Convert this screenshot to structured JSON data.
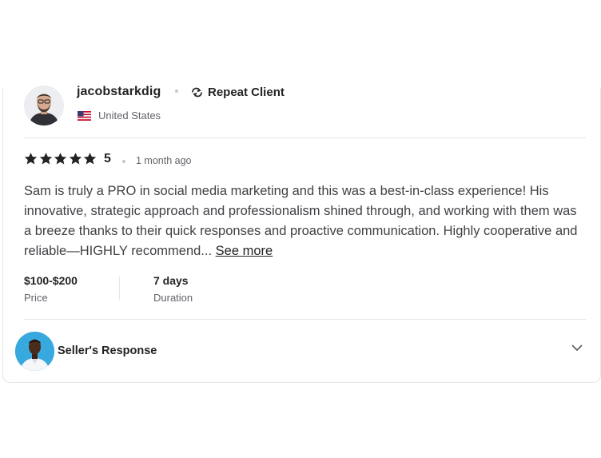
{
  "reviewer": {
    "username": "jacobstarkdig",
    "badge": "Repeat Client",
    "country": "United States",
    "avatar_icon": "reviewer-photo-icon"
  },
  "review": {
    "rating": "5",
    "stars_filled": 5,
    "date": "1 month ago",
    "text": "Sam is truly a PRO in social media marketing and this was a best-in-class experience! His innovative, strategic approach and professionalism shined through, and working with them was a breeze thanks to their quick responses and proactive communication. Highly cooperative and reliable—HIGHLY recommend...",
    "see_more": "See more"
  },
  "stats": {
    "price_value": "$100-$200",
    "price_label": "Price",
    "duration_value": "7 days",
    "duration_label": "Duration"
  },
  "seller_response": {
    "title": "Seller's Response",
    "avatar_icon": "seller-photo-icon",
    "toggle_icon": "chevron-down-icon"
  },
  "colors": {
    "text_primary": "#222325",
    "text_secondary": "#62646a",
    "border": "#e4e5e7",
    "seller_avatar_bg": "#38a9df"
  }
}
